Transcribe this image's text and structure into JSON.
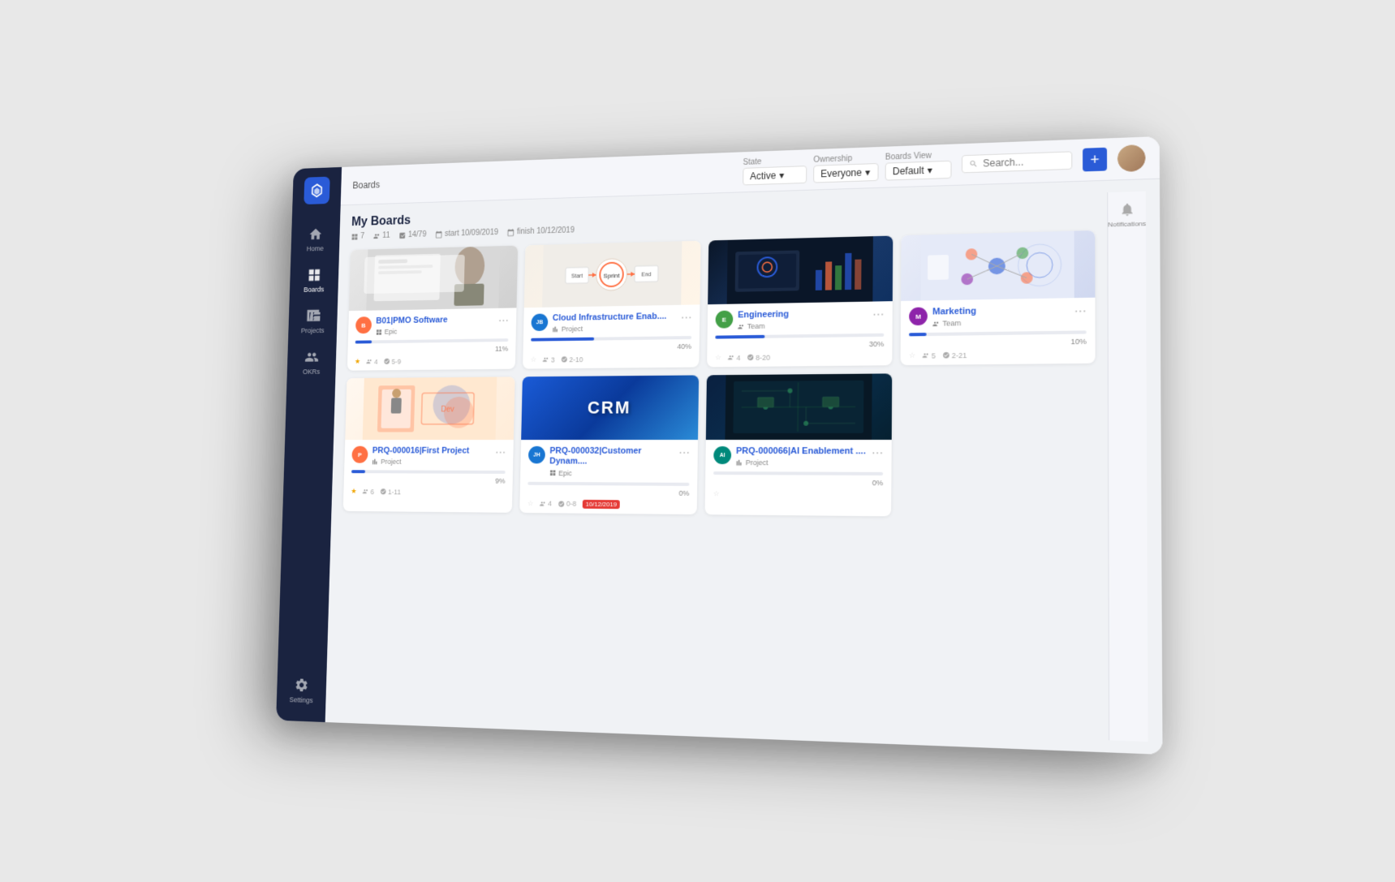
{
  "app": {
    "title": "Boards",
    "breadcrumb": "Boards"
  },
  "sidebar": {
    "items": [
      {
        "id": "home",
        "label": "Home",
        "icon": "home"
      },
      {
        "id": "boards",
        "label": "Boards",
        "icon": "boards",
        "active": true
      },
      {
        "id": "projects",
        "label": "Projects",
        "icon": "projects"
      },
      {
        "id": "okrs",
        "label": "OKRs",
        "icon": "okrs"
      }
    ],
    "settings_label": "Settings"
  },
  "header": {
    "filters": {
      "state_label": "State",
      "state_value": "Active",
      "ownership_label": "Ownership",
      "ownership_value": "Everyone",
      "boards_view_label": "Boards View",
      "boards_view_value": "Default"
    },
    "search_placeholder": "Search...",
    "add_label": "+",
    "profile_label": "Profile"
  },
  "notifications": {
    "label": "Notifications"
  },
  "boards": {
    "title": "My Boards",
    "meta": {
      "count": "7",
      "members": "11",
      "tasks": "14/79",
      "start": "start 10/09/2019",
      "finish": "finish 10/12/2019"
    },
    "cards": [
      {
        "id": "card1",
        "title": "B01|PMO Software",
        "type": "Epic",
        "type_icon": "epic",
        "avatar_color": "orange",
        "avatar_text": "B",
        "progress": 11,
        "stars": true,
        "members": "4",
        "tasks": "5-9",
        "img_class": "img-board-1"
      },
      {
        "id": "card2",
        "title": "Cloud Infrastructure Enab....",
        "type": "Project",
        "type_icon": "project",
        "avatar_color": "blue",
        "avatar_text": "JB",
        "progress": 40,
        "stars": false,
        "members": "3",
        "tasks": "2-10",
        "img_class": "img-board-2"
      },
      {
        "id": "card3",
        "title": "Engineering",
        "type": "Team",
        "type_icon": "team",
        "avatar_color": "green",
        "avatar_text": "E",
        "progress": 30,
        "stars": false,
        "members": "4",
        "tasks": "8-20",
        "img_class": "img-board-3"
      },
      {
        "id": "card4",
        "title": "Marketing",
        "type": "Team",
        "type_icon": "team",
        "avatar_color": "purple",
        "avatar_text": "M",
        "progress": 10,
        "stars": false,
        "members": "5",
        "tasks": "2-21",
        "img_class": "img-board-4"
      },
      {
        "id": "card5",
        "title": "PRQ-000016|First Project",
        "type": "Project",
        "type_icon": "project",
        "avatar_color": "orange",
        "avatar_text": "P",
        "progress": 9,
        "stars": true,
        "members": "6",
        "tasks": "1-11",
        "img_class": "img-board-5"
      },
      {
        "id": "card6",
        "title": "PRQ-000032|Customer Dynam....",
        "type": "Epic",
        "type_icon": "epic",
        "avatar_color": "blue",
        "avatar_text": "JH",
        "progress": 0,
        "stars": false,
        "members": "4",
        "tasks": "0-8",
        "due_date": "10/12/2019",
        "img_class": "img-board-6"
      },
      {
        "id": "card7",
        "title": "PRQ-000066|AI Enablement ....",
        "type": "Project",
        "type_icon": "project",
        "avatar_color": "teal",
        "avatar_text": "AI",
        "progress": 0,
        "stars": false,
        "members": "",
        "tasks": "",
        "img_class": "img-board-7"
      }
    ]
  }
}
